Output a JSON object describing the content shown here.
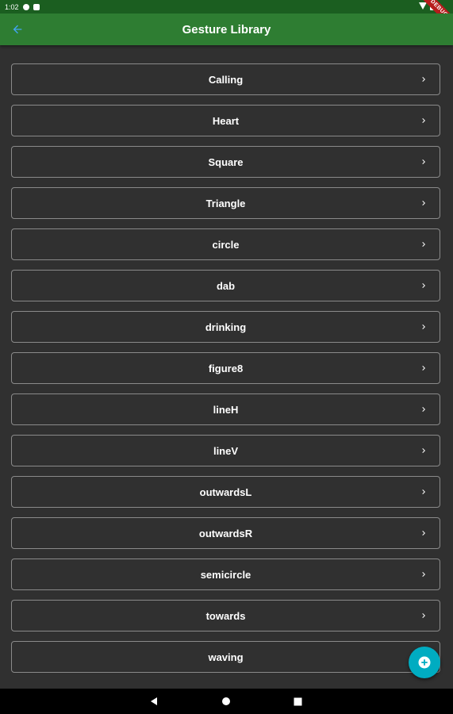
{
  "status_bar": {
    "time": "1:02"
  },
  "debug_banner": "DEBUG",
  "app_bar": {
    "title": "Gesture Library",
    "back_icon": "arrow-back-icon"
  },
  "gestures": [
    {
      "label": "Calling"
    },
    {
      "label": "Heart"
    },
    {
      "label": "Square"
    },
    {
      "label": "Triangle"
    },
    {
      "label": "circle"
    },
    {
      "label": "dab"
    },
    {
      "label": "drinking"
    },
    {
      "label": "figure8"
    },
    {
      "label": "lineH"
    },
    {
      "label": "lineV"
    },
    {
      "label": "outwardsL"
    },
    {
      "label": "outwardsR"
    },
    {
      "label": "semicircle"
    },
    {
      "label": "towards"
    },
    {
      "label": "waving"
    }
  ],
  "fab": {
    "icon": "add-circle-icon"
  },
  "nav_bar": {
    "back_icon": "nav-back-icon",
    "home_icon": "nav-home-icon",
    "recents_icon": "nav-recents-icon"
  },
  "colors": {
    "app_bar": "#2e7d32",
    "status_bar": "#1b5e20",
    "background": "#303030",
    "fab": "#00acc1",
    "back_arrow": "#42a5f5"
  }
}
